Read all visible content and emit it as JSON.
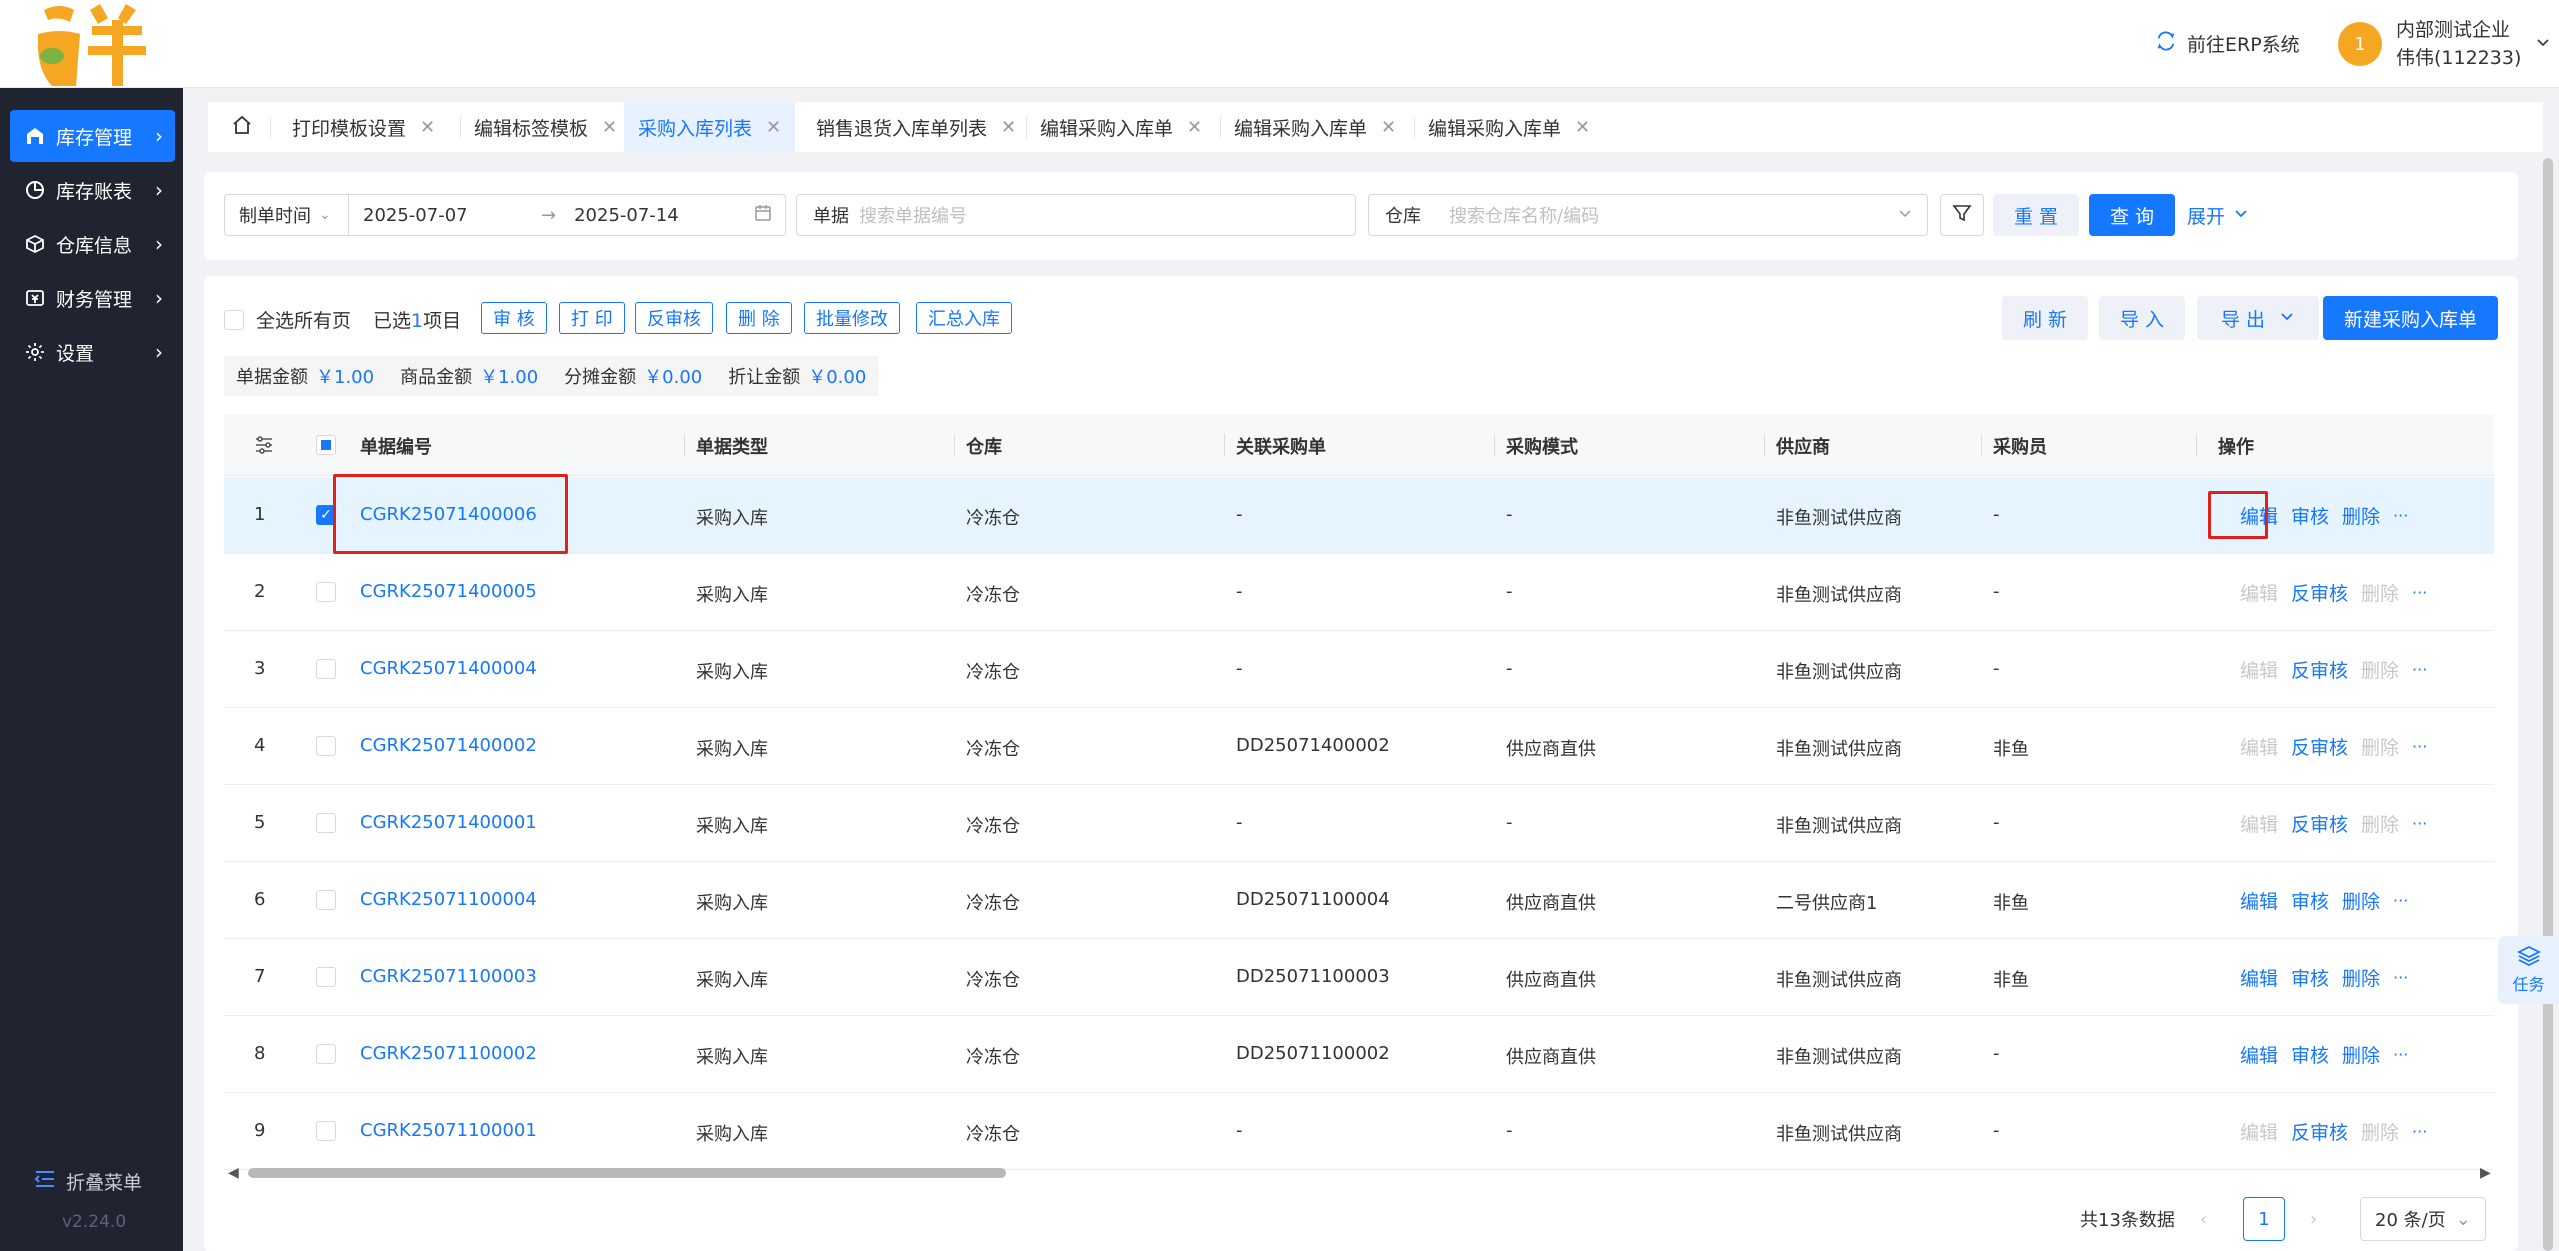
{
  "header": {
    "erp_link": "前往ERP系统",
    "avatar_badge": "1",
    "company": "内部测试企业",
    "user": "伟伟(112233)"
  },
  "sidebar": {
    "items": [
      {
        "label": "库存管理"
      },
      {
        "label": "库存账表"
      },
      {
        "label": "仓库信息"
      },
      {
        "label": "财务管理"
      },
      {
        "label": "设置"
      }
    ],
    "fold_label": "折叠菜单",
    "version": "v2.24.0"
  },
  "tabs": [
    {
      "label": "打印模板设置"
    },
    {
      "label": "编辑标签模板"
    },
    {
      "label": "采购入库列表"
    },
    {
      "label": "销售退货入库单列表"
    },
    {
      "label": "编辑采购入库单"
    },
    {
      "label": "编辑采购入库单"
    },
    {
      "label": "编辑采购入库单"
    }
  ],
  "filter": {
    "date_type": "制单时间",
    "date_start": "2025-07-07",
    "date_end": "2025-07-14",
    "doc_label": "单据",
    "doc_placeholder": "搜索单据编号",
    "warehouse_label": "仓库",
    "warehouse_placeholder": "搜索仓库名称/编码",
    "reset": "重 置",
    "query": "查 询",
    "expand": "展开"
  },
  "toolbar": {
    "select_all": "全选所有页",
    "selected": "已选",
    "selected_count": "1",
    "selected_unit": "项目",
    "audit": "审 核",
    "print": "打 印",
    "unaudit": "反审核",
    "delete": "删 除",
    "batch_edit": "批量修改",
    "summary_in": "汇总入库",
    "refresh": "刷 新",
    "import": "导 入",
    "export": "导 出",
    "new": "新建采购入库单"
  },
  "summary": {
    "doc_amount_label": "单据金额",
    "doc_amount": "￥1.00",
    "goods_amount_label": "商品金额",
    "goods_amount": "￥1.00",
    "alloc_amount_label": "分摊金额",
    "alloc_amount": "￥0.00",
    "discount_label": "折让金额",
    "discount": "￥0.00"
  },
  "table": {
    "columns": [
      "单据编号",
      "单据类型",
      "仓库",
      "关联采购单",
      "采购模式",
      "供应商",
      "采购员",
      "操作"
    ],
    "rows": [
      {
        "idx": "1",
        "code": "CGRK25071400006",
        "type": "采购入库",
        "wh": "冷冻仓",
        "po": "-",
        "mode": "-",
        "supplier": "非鱼测试供应商",
        "buyer": "-",
        "ops": [
          "编辑",
          "审核",
          "删除"
        ],
        "state": "draft",
        "checked": true
      },
      {
        "idx": "2",
        "code": "CGRK25071400005",
        "type": "采购入库",
        "wh": "冷冻仓",
        "po": "-",
        "mode": "-",
        "supplier": "非鱼测试供应商",
        "buyer": "-",
        "ops": [
          "编辑",
          "反审核",
          "删除"
        ],
        "state": "audited",
        "checked": false
      },
      {
        "idx": "3",
        "code": "CGRK25071400004",
        "type": "采购入库",
        "wh": "冷冻仓",
        "po": "-",
        "mode": "-",
        "supplier": "非鱼测试供应商",
        "buyer": "-",
        "ops": [
          "编辑",
          "反审核",
          "删除"
        ],
        "state": "audited",
        "checked": false
      },
      {
        "idx": "4",
        "code": "CGRK25071400002",
        "type": "采购入库",
        "wh": "冷冻仓",
        "po": "DD25071400002",
        "mode": "供应商直供",
        "supplier": "非鱼测试供应商",
        "buyer": "非鱼",
        "ops": [
          "编辑",
          "反审核",
          "删除"
        ],
        "state": "audited",
        "checked": false
      },
      {
        "idx": "5",
        "code": "CGRK25071400001",
        "type": "采购入库",
        "wh": "冷冻仓",
        "po": "-",
        "mode": "-",
        "supplier": "非鱼测试供应商",
        "buyer": "-",
        "ops": [
          "编辑",
          "反审核",
          "删除"
        ],
        "state": "audited",
        "checked": false
      },
      {
        "idx": "6",
        "code": "CGRK25071100004",
        "type": "采购入库",
        "wh": "冷冻仓",
        "po": "DD25071100004",
        "mode": "供应商直供",
        "supplier": "二号供应商1",
        "buyer": "非鱼",
        "ops": [
          "编辑",
          "审核",
          "删除"
        ],
        "state": "draft",
        "checked": false
      },
      {
        "idx": "7",
        "code": "CGRK25071100003",
        "type": "采购入库",
        "wh": "冷冻仓",
        "po": "DD25071100003",
        "mode": "供应商直供",
        "supplier": "非鱼测试供应商",
        "buyer": "非鱼",
        "ops": [
          "编辑",
          "审核",
          "删除"
        ],
        "state": "draft",
        "checked": false
      },
      {
        "idx": "8",
        "code": "CGRK25071100002",
        "type": "采购入库",
        "wh": "冷冻仓",
        "po": "DD25071100002",
        "mode": "供应商直供",
        "supplier": "非鱼测试供应商",
        "buyer": "-",
        "ops": [
          "编辑",
          "审核",
          "删除"
        ],
        "state": "draft",
        "checked": false
      },
      {
        "idx": "9",
        "code": "CGRK25071100001",
        "type": "采购入库",
        "wh": "冷冻仓",
        "po": "-",
        "mode": "-",
        "supplier": "非鱼测试供应商",
        "buyer": "-",
        "ops": [
          "编辑",
          "反审核",
          "删除"
        ],
        "state": "audited",
        "checked": false
      }
    ],
    "more": "···"
  },
  "pagination": {
    "total": "共13条数据",
    "current": "1",
    "page_size": "20 条/页"
  },
  "task": {
    "label": "任务"
  },
  "colors": {
    "primary": "#1677ff",
    "sidebar": "#1f2430",
    "logo": "#f5a623",
    "highlight": "#e0201b"
  }
}
